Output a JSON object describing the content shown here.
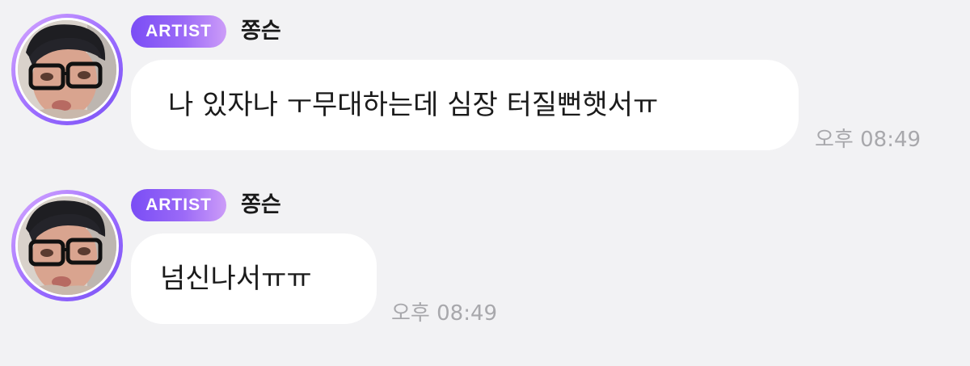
{
  "messages": [
    {
      "badge": "ARTIST",
      "sender": "쫑슨",
      "text": "나 있자나 ㅜ무대하는데 심장 터질뻔햇서ㅠ",
      "time": "오후 08:49"
    },
    {
      "badge": "ARTIST",
      "sender": "쫑슨",
      "text": "넘신나서ㅠㅠ",
      "time": "오후 08:49"
    }
  ],
  "colors": {
    "background": "#f2f2f4",
    "bubble": "#ffffff",
    "badge_start": "#7a4df5",
    "badge_end": "#cc9cf8",
    "avatar_ring": "#9a6bff",
    "time_text": "#a8a8ac",
    "text": "#1a1a1a"
  },
  "icons": {
    "avatar": "artist-profile-photo"
  }
}
